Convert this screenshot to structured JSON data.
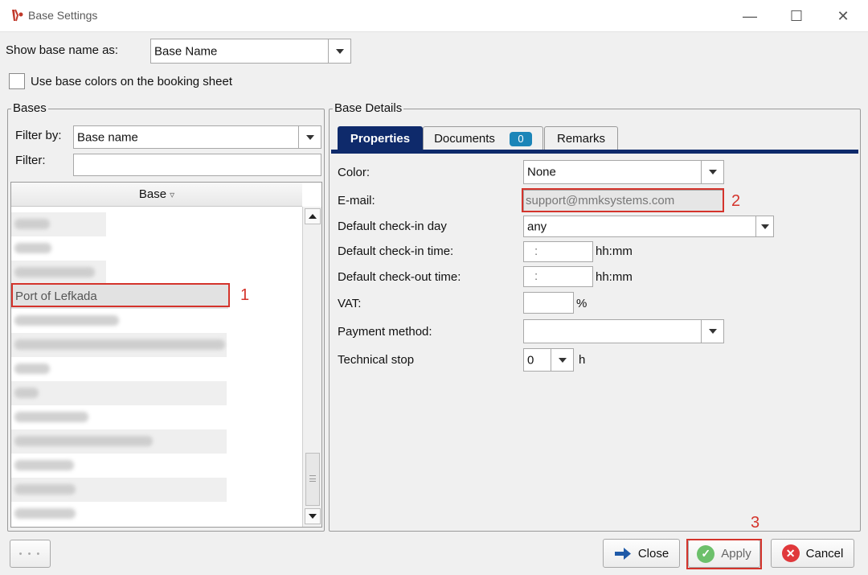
{
  "window": {
    "title": "Base Settings",
    "minimize_glyph": "—",
    "maximize_glyph": "☐",
    "close_glyph": "✕"
  },
  "show_base_name": {
    "label": "Show base name as:",
    "value": "Base Name"
  },
  "use_colors": {
    "label": "Use base colors on the booking sheet",
    "checked": false
  },
  "bases": {
    "legend": "Bases",
    "filter_by_label": "Filter by:",
    "filter_by_value": "Base name",
    "filter_label": "Filter:",
    "filter_value": "",
    "column_header": "Base",
    "sort_glyph": "▿",
    "selected_row": "Port of Lefkada"
  },
  "details": {
    "legend": "Base Details",
    "tabs": {
      "properties": "Properties",
      "documents": "Documents",
      "documents_count": "0",
      "remarks": "Remarks"
    },
    "color_label": "Color:",
    "color_value": "None",
    "email_label": "E-mail:",
    "email_value": "support@mmksystems.com",
    "checkin_day_label": "Default check-in day",
    "checkin_day_value": "any",
    "checkin_time_label": "Default check-in time:",
    "checkin_time_value": ":",
    "checkin_time_unit": "hh:mm",
    "checkout_time_label": "Default check-out time:",
    "checkout_time_value": ":",
    "checkout_time_unit": "hh:mm",
    "vat_label": "VAT:",
    "vat_value": "",
    "vat_unit": "%",
    "payment_label": "Payment method:",
    "payment_value": "",
    "tech_stop_label": "Technical stop",
    "tech_stop_value": "0",
    "tech_stop_unit": "h"
  },
  "annotations": {
    "one": "1",
    "two": "2",
    "three": "3"
  },
  "footer": {
    "more": "• • •",
    "close": "Close",
    "apply": "Apply",
    "cancel": "Cancel"
  },
  "colors": {
    "accent": "#0e2a6b",
    "badge": "#1b85b8",
    "annotation": "#d4342c",
    "apply_icon": "#6cc06b",
    "cancel_icon": "#e0383b",
    "close_icon": "#1f5aa8"
  }
}
